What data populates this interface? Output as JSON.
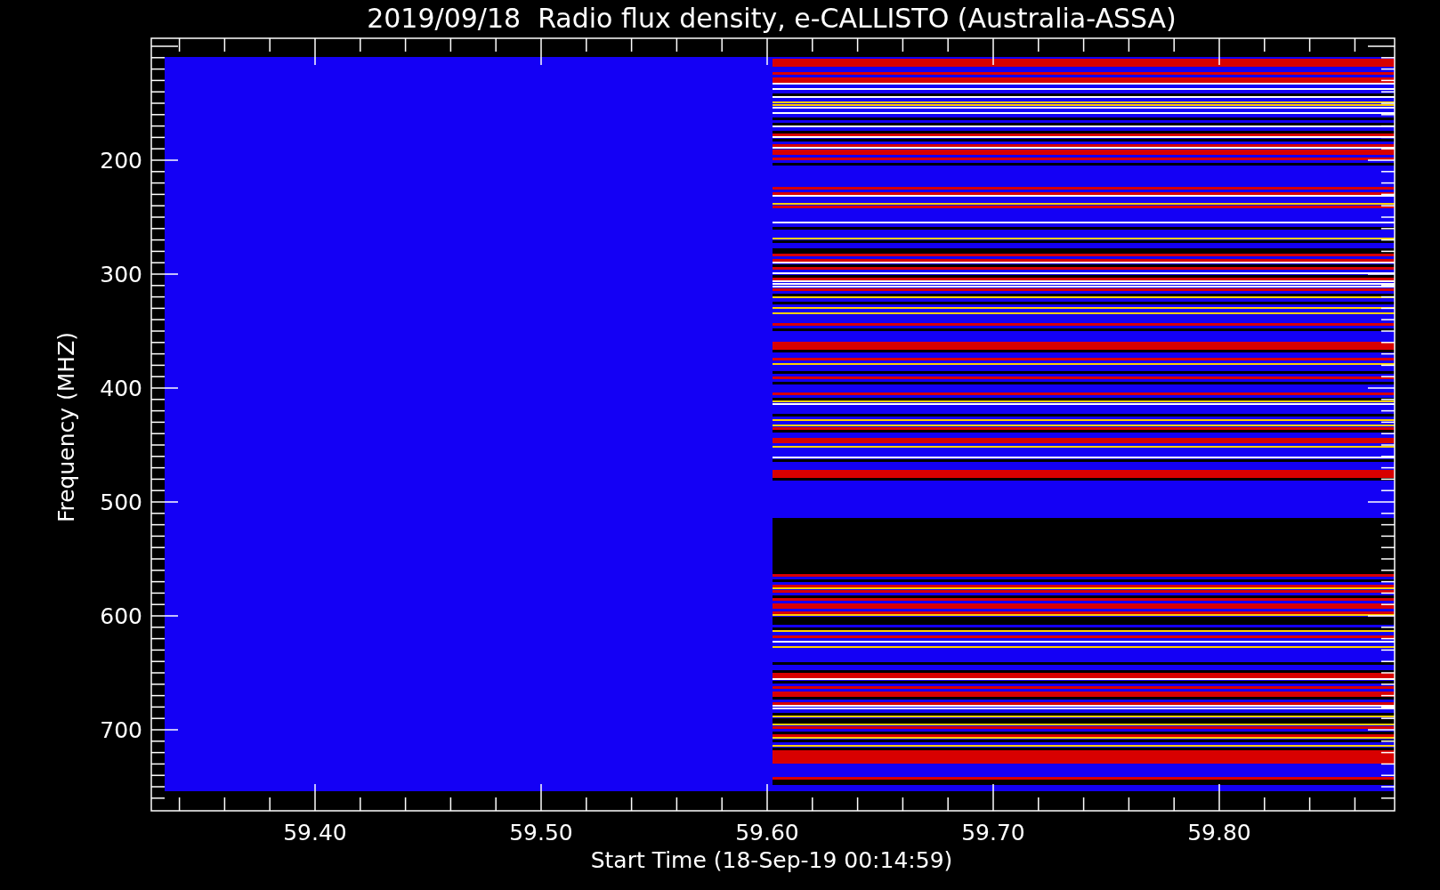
{
  "plot": {
    "title": "2019/09/18  Radio flux density, e-CALLISTO (Australia-ASSA)",
    "xlabel": "Start Time (18-Sep-19 00:14:59)",
    "ylabel": "Frequency (MHZ)",
    "x_tick_labels": [
      "59.40",
      "59.50",
      "59.60",
      "59.70",
      "59.80"
    ],
    "y_tick_labels": [
      "200",
      "300",
      "400",
      "500",
      "600",
      "700"
    ]
  }
}
